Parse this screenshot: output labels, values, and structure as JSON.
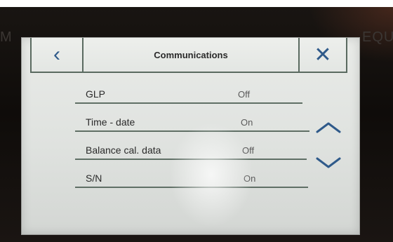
{
  "device": {
    "bezel_left_text": "M",
    "bezel_right_text": "EQU"
  },
  "header": {
    "title": "Communications",
    "back_icon": "chevron-left-icon",
    "close_icon": "close-icon"
  },
  "settings": {
    "items": [
      {
        "label": "GLP",
        "value": "Off"
      },
      {
        "label": "Time - date",
        "value": "On"
      },
      {
        "label": "Balance cal. data",
        "value": "Off"
      },
      {
        "label": "S/N",
        "value": "On"
      }
    ]
  },
  "scroll": {
    "up_icon": "chevron-up-icon",
    "down_icon": "chevron-down-icon"
  },
  "colors": {
    "accent": "#2f5a8a",
    "screen_bg": "#e3e6e3",
    "divider": "#5f6f65"
  }
}
